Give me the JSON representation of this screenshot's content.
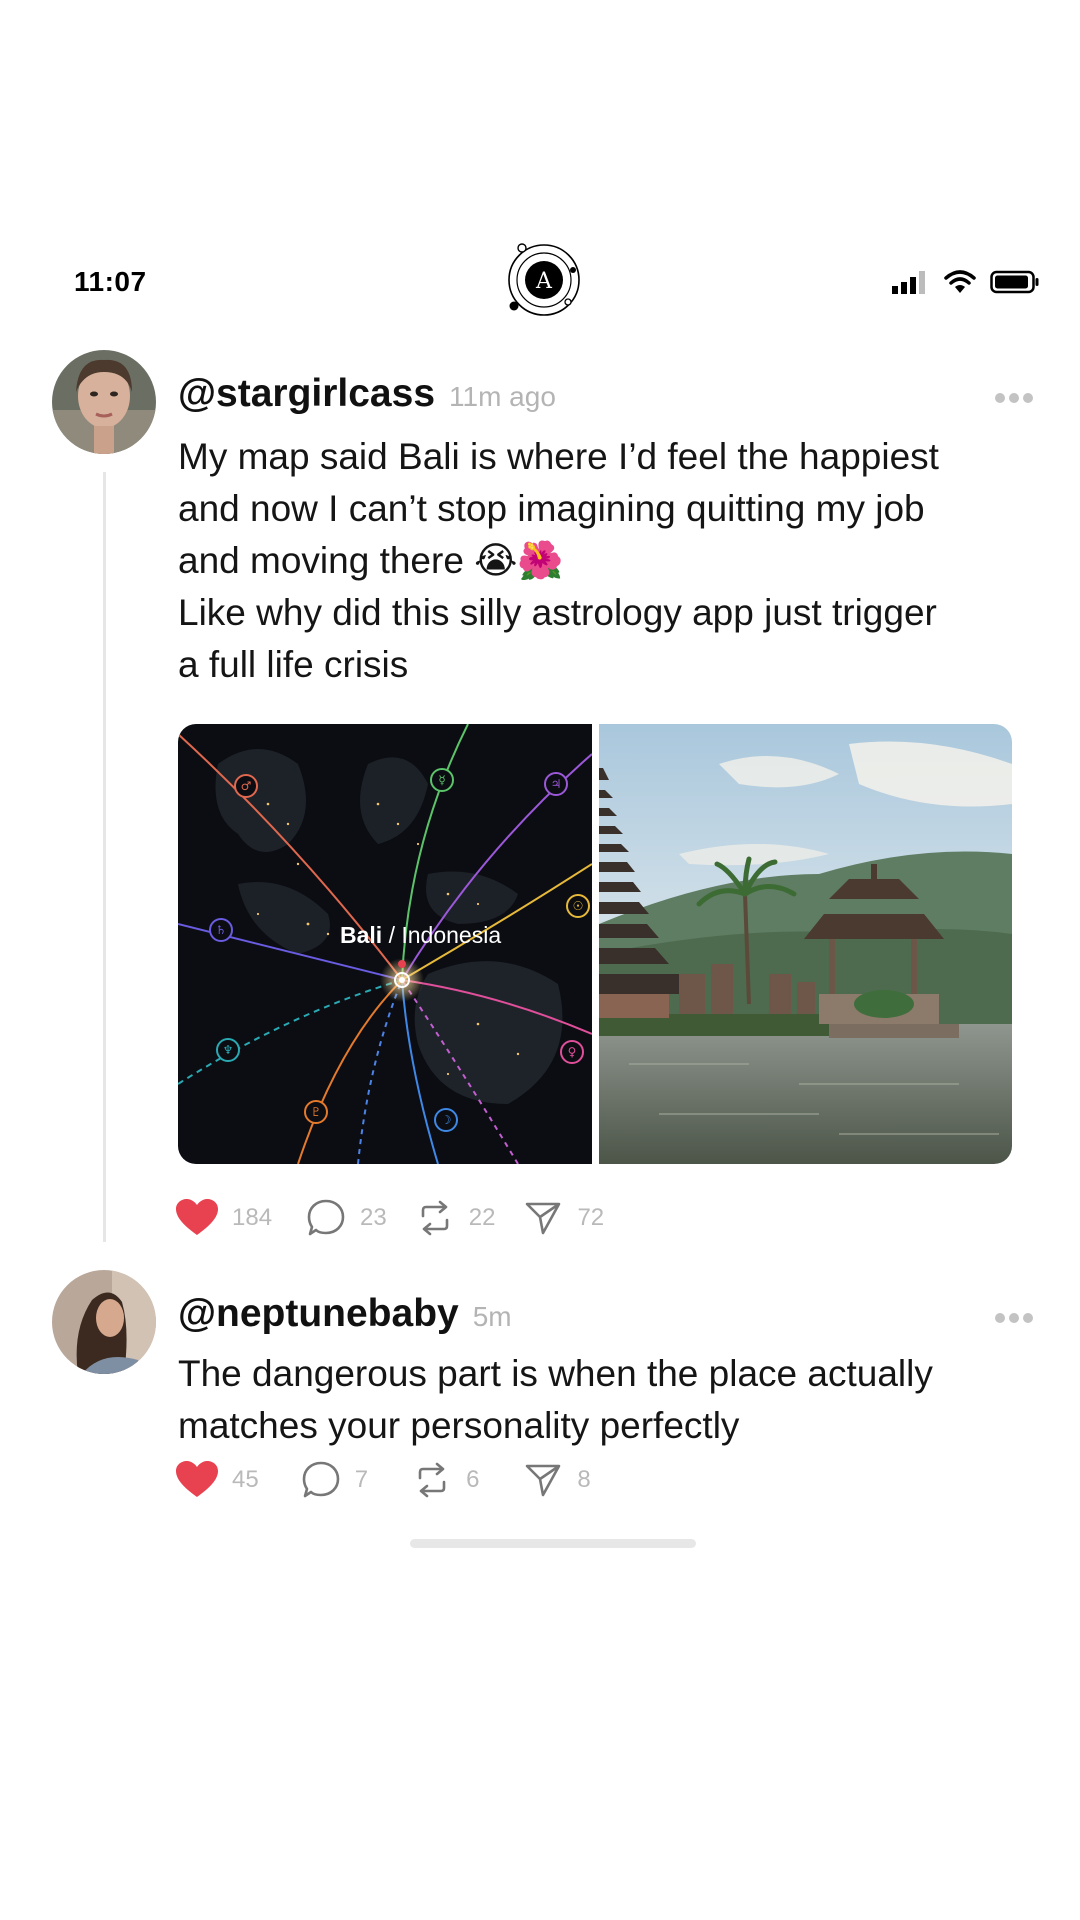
{
  "status_bar": {
    "time": "11:07",
    "icons": [
      "signal-icon",
      "wifi-icon",
      "battery-icon"
    ]
  },
  "app": {
    "logo_letter": "A",
    "logo_icon": "astrology-app-logo"
  },
  "colors": {
    "like": "#e8414f",
    "muted": "#b9b9b9",
    "divider": "#e6e6e6"
  },
  "posts": [
    {
      "handle": "@stargirlcass",
      "time_ago": "11m ago",
      "body_lines": [
        "My map said Bali is where I’d feel the happiest",
        "and now I can’t stop imagining quitting my job",
        "and moving there 😭🌺",
        "Like why did this silly astrology app just trigger",
        "a full life crisis"
      ],
      "media": {
        "map_label_bold": "Bali",
        "map_label_rest": " / Indonesia"
      },
      "actions": {
        "likes": "184",
        "comments": "23",
        "reposts": "22",
        "shares": "72"
      }
    },
    {
      "handle": "@neptunebaby",
      "time_ago": "5m",
      "body_lines": [
        "The dangerous part is when the place actually",
        "matches your personality perfectly"
      ],
      "actions": {
        "likes": "45",
        "comments": "7",
        "reposts": "6",
        "shares": "8"
      }
    }
  ]
}
